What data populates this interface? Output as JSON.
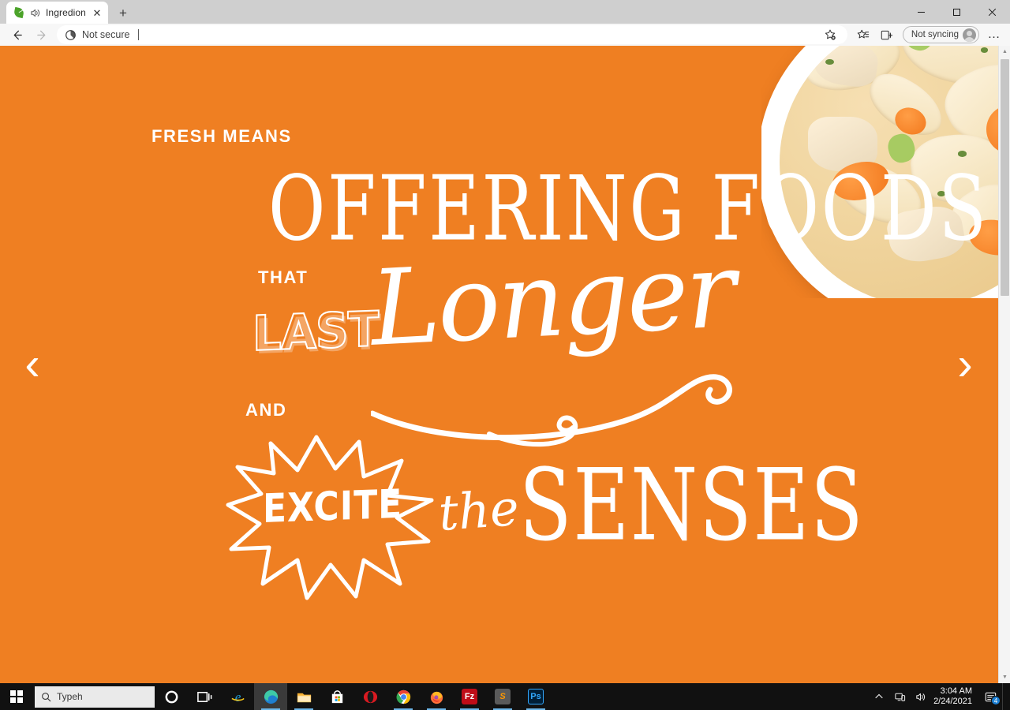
{
  "browser": {
    "tab": {
      "title": "Ingredion",
      "favicon": "leaf-icon",
      "audio_icon": "speaker-playing-icon",
      "close_label": "✕"
    },
    "newtab_label": "+",
    "window_controls": {
      "minimize": "minimize-icon",
      "maximize": "maximize-icon",
      "close": "close-icon"
    },
    "toolbar": {
      "back": "back-arrow-icon",
      "forward": "forward-arrow-icon",
      "security_label": "Not secure",
      "security_icon": "not-secure-icon",
      "url_value": "",
      "favorite_icon": "add-favorite-star-icon",
      "favorites_icon": "favorites-list-icon",
      "collections_icon": "collections-icon",
      "profile_label": "Not syncing",
      "profile_avatar": "user-avatar-icon",
      "settings_label": "…"
    }
  },
  "page": {
    "background_color": "#EF7F22",
    "text_color": "#FFFFFF",
    "carousel": {
      "prev_label": "‹",
      "next_label": "›"
    },
    "hero": {
      "kicker": "FRESH MEANS",
      "line_offering": "OFFERING FOODS",
      "word_that": "THAT",
      "word_last": "LAST",
      "word_longer": "Longer",
      "word_and": "AND",
      "word_excite": "EXCITE",
      "word_the": "the",
      "word_senses": "SENSES",
      "image_alt": "bowl-of-chicken-noodle-soup"
    },
    "scrollbar": {
      "up_label": "▲",
      "down_label": "▼"
    }
  },
  "taskbar": {
    "start_label": "start-icon",
    "search_placeholder": "Typeh",
    "search_icon": "search-icon",
    "apps": [
      {
        "name": "cortana",
        "label": "O"
      },
      {
        "name": "task-view",
        "label": "task-view-icon"
      },
      {
        "name": "internet-explorer",
        "label": "e"
      },
      {
        "name": "microsoft-edge",
        "label": "edge-icon"
      },
      {
        "name": "file-explorer",
        "label": "folder-icon"
      },
      {
        "name": "microsoft-store",
        "label": "store-icon"
      },
      {
        "name": "opera",
        "label": "opera-icon"
      },
      {
        "name": "google-chrome",
        "label": "chrome-icon"
      },
      {
        "name": "mozilla-firefox",
        "label": "firefox-icon"
      },
      {
        "name": "filezilla",
        "label": "Fz"
      },
      {
        "name": "sublime-text",
        "label": "S"
      },
      {
        "name": "photoshop",
        "label": "Ps"
      }
    ],
    "tray": {
      "show_hidden": "∧",
      "network_icon": "network-icon",
      "volume_icon": "volume-icon",
      "time": "3:04 AM",
      "date": "2/24/2021",
      "notification_icon": "action-center-icon",
      "notification_count": "4"
    }
  }
}
